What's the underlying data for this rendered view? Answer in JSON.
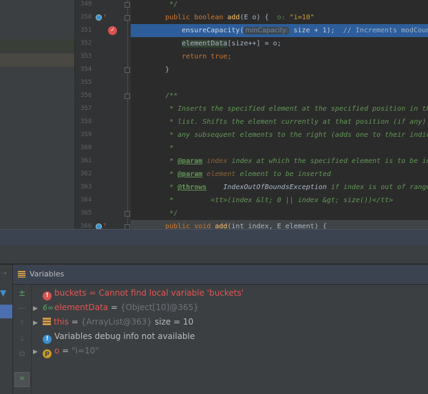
{
  "editor": {
    "lines": [
      {
        "n": "349",
        "segs": [
          {
            "t": "     */",
            "c": "#629755"
          }
        ]
      },
      {
        "n": "350",
        "segs": [
          {
            "t": "    public boolean ",
            "c": "#cc7832"
          },
          {
            "t": "add",
            "c": "#ffc66d"
          },
          {
            "t": "(E o) {  ",
            "c": "#a9b7c6"
          },
          {
            "t": "o: ",
            "c": "#608b4e"
          },
          {
            "t": "\"i=10\"",
            "c": "#c9a236"
          }
        ],
        "icons": [
          "override-icon"
        ]
      },
      {
        "n": "351",
        "segs": [
          {
            "t": "        ensureCapacity(",
            "c": "#d0d8e0"
          },
          {
            "hint": "minCapacity:"
          },
          {
            "t": " size + 1);  ",
            "c": "#c8d0da"
          },
          {
            "t": "// Increments modCount!!",
            "c": "#9fb2c8"
          }
        ],
        "highlight": "#2d5d9b",
        "breakpoint": true
      },
      {
        "n": "352",
        "segs": [
          {
            "t": "elementData",
            "c": "#a9b7c6",
            "bg": "#344134",
            "pad": "        "
          },
          {
            "t": "[size++] = o;",
            "c": "#a9b7c6"
          }
        ]
      },
      {
        "n": "353",
        "segs": [
          {
            "t": "        return true;",
            "c": "#cc7832"
          }
        ]
      },
      {
        "n": "354",
        "segs": [
          {
            "t": "    }",
            "c": "#a9b7c6"
          }
        ]
      },
      {
        "n": "355",
        "segs": []
      },
      {
        "n": "356",
        "segs": [
          {
            "t": "    /**",
            "c": "#629755"
          }
        ]
      },
      {
        "n": "357",
        "segs": [
          {
            "t": "     * Inserts the specified element at the specified position in this",
            "c": "#629755",
            "i": true
          }
        ]
      },
      {
        "n": "358",
        "segs": [
          {
            "t": "     * list. Shifts the element currently at that position (if any) and",
            "c": "#629755",
            "i": true
          }
        ]
      },
      {
        "n": "359",
        "segs": [
          {
            "t": "     * any subsequent elements to the right (adds one to their indices).",
            "c": "#629755",
            "i": true
          }
        ]
      },
      {
        "n": "360",
        "segs": [
          {
            "t": "     *",
            "c": "#629755"
          }
        ]
      },
      {
        "n": "361",
        "segs": [
          {
            "t": "     * ",
            "c": "#629755"
          },
          {
            "t": "@param",
            "c": "#629755",
            "tag": true
          },
          {
            "t": " index",
            "c": "#8a653b",
            "i": true
          },
          {
            "t": " index at which the specified element is to be inserted",
            "c": "#629755",
            "i": true
          }
        ]
      },
      {
        "n": "362",
        "segs": [
          {
            "t": "     * ",
            "c": "#629755"
          },
          {
            "t": "@param",
            "c": "#629755",
            "tag": true
          },
          {
            "t": " element",
            "c": "#8a653b",
            "i": true
          },
          {
            "t": " element to be inserted",
            "c": "#629755",
            "i": true
          }
        ]
      },
      {
        "n": "363",
        "segs": [
          {
            "t": "     * ",
            "c": "#629755"
          },
          {
            "t": "@throws",
            "c": "#629755",
            "tag": true
          },
          {
            "t": "    IndexOutOfBoundsException",
            "c": "#a9b7c6",
            "i": true
          },
          {
            "t": " if index is out of range",
            "c": "#629755",
            "i": true
          }
        ]
      },
      {
        "n": "364",
        "segs": [
          {
            "t": "     *         <tt>(index &lt; 0 || index &gt; size())</tt>",
            "c": "#629755",
            "i": true
          }
        ]
      },
      {
        "n": "365",
        "segs": [
          {
            "t": "     */",
            "c": "#629755"
          }
        ]
      },
      {
        "n": "366",
        "segs": [
          {
            "t": "    public void ",
            "c": "#cc7832"
          },
          {
            "t": "add",
            "c": "#ffc66d"
          },
          {
            "t": "(int index, E element) {",
            "c": "#a9b7c6"
          }
        ],
        "highlight": "#414446",
        "icons": [
          "override-icon"
        ]
      }
    ],
    "fold_lines": [
      "349",
      "350",
      "354",
      "356",
      "365",
      "366"
    ]
  },
  "colors": {
    "accent": "#2d5d9b",
    "error": "#e05555",
    "breakpoint": "#d9534f"
  },
  "variables_panel": {
    "title": "Variables",
    "rows": [
      {
        "icon": "error-icon",
        "name": "buckets",
        "sep": " = ",
        "value": "Cannot find local variable 'buckets'",
        "expandable": false,
        "style": "error"
      },
      {
        "icon": "field-watch-icon",
        "name": "elementData",
        "sep": " = ",
        "value": "{Object[10]@365}",
        "expandable": true
      },
      {
        "icon": "object-icon",
        "name": "this",
        "sep": " = ",
        "value": "{ArrayList@363}",
        "extra": "  size = 10",
        "expandable": true
      },
      {
        "icon": "info-icon",
        "name": "",
        "sep": "",
        "value": "",
        "message": "Variables debug info not available",
        "expandable": false
      },
      {
        "icon": "parameter-icon",
        "name": "o",
        "sep": " = ",
        "value": "\"i=10\"",
        "expandable": true
      }
    ]
  }
}
